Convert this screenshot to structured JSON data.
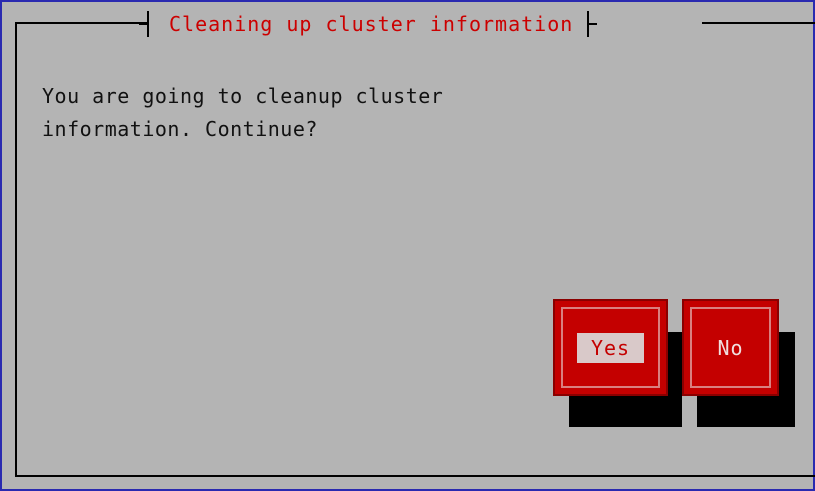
{
  "dialog": {
    "title": "Cleaning up cluster information",
    "message_line1": "You are going to cleanup cluster",
    "message_line2": "information. Continue?"
  },
  "buttons": {
    "yes_label": "Yes",
    "no_label": "No",
    "focused": "yes"
  },
  "colors": {
    "background": "#b4b4b4",
    "accent_red": "#c40000",
    "title_text": "#cc0000",
    "window_border": "#2a2ab0"
  }
}
